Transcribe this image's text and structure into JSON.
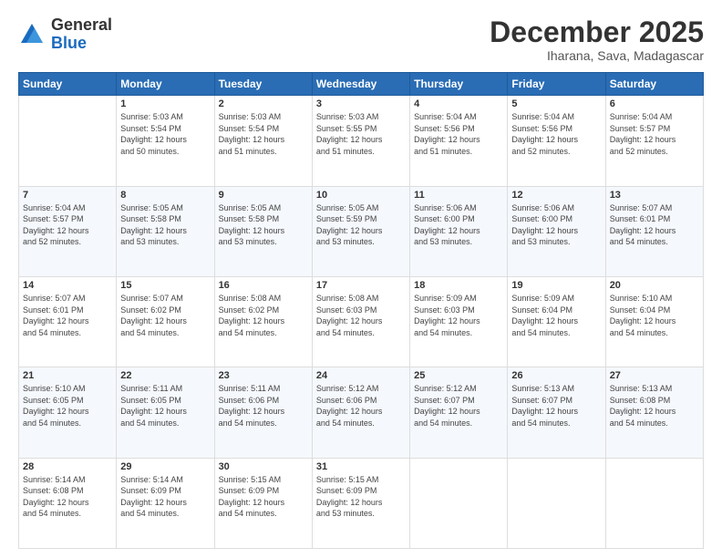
{
  "header": {
    "logo_general": "General",
    "logo_blue": "Blue",
    "month_title": "December 2025",
    "subtitle": "Iharana, Sava, Madagascar"
  },
  "weekdays": [
    "Sunday",
    "Monday",
    "Tuesday",
    "Wednesday",
    "Thursday",
    "Friday",
    "Saturday"
  ],
  "weeks": [
    [
      {
        "day": "",
        "info": ""
      },
      {
        "day": "1",
        "info": "Sunrise: 5:03 AM\nSunset: 5:54 PM\nDaylight: 12 hours\nand 50 minutes."
      },
      {
        "day": "2",
        "info": "Sunrise: 5:03 AM\nSunset: 5:54 PM\nDaylight: 12 hours\nand 51 minutes."
      },
      {
        "day": "3",
        "info": "Sunrise: 5:03 AM\nSunset: 5:55 PM\nDaylight: 12 hours\nand 51 minutes."
      },
      {
        "day": "4",
        "info": "Sunrise: 5:04 AM\nSunset: 5:56 PM\nDaylight: 12 hours\nand 51 minutes."
      },
      {
        "day": "5",
        "info": "Sunrise: 5:04 AM\nSunset: 5:56 PM\nDaylight: 12 hours\nand 52 minutes."
      },
      {
        "day": "6",
        "info": "Sunrise: 5:04 AM\nSunset: 5:57 PM\nDaylight: 12 hours\nand 52 minutes."
      }
    ],
    [
      {
        "day": "7",
        "info": "Sunrise: 5:04 AM\nSunset: 5:57 PM\nDaylight: 12 hours\nand 52 minutes."
      },
      {
        "day": "8",
        "info": "Sunrise: 5:05 AM\nSunset: 5:58 PM\nDaylight: 12 hours\nand 53 minutes."
      },
      {
        "day": "9",
        "info": "Sunrise: 5:05 AM\nSunset: 5:58 PM\nDaylight: 12 hours\nand 53 minutes."
      },
      {
        "day": "10",
        "info": "Sunrise: 5:05 AM\nSunset: 5:59 PM\nDaylight: 12 hours\nand 53 minutes."
      },
      {
        "day": "11",
        "info": "Sunrise: 5:06 AM\nSunset: 6:00 PM\nDaylight: 12 hours\nand 53 minutes."
      },
      {
        "day": "12",
        "info": "Sunrise: 5:06 AM\nSunset: 6:00 PM\nDaylight: 12 hours\nand 53 minutes."
      },
      {
        "day": "13",
        "info": "Sunrise: 5:07 AM\nSunset: 6:01 PM\nDaylight: 12 hours\nand 54 minutes."
      }
    ],
    [
      {
        "day": "14",
        "info": "Sunrise: 5:07 AM\nSunset: 6:01 PM\nDaylight: 12 hours\nand 54 minutes."
      },
      {
        "day": "15",
        "info": "Sunrise: 5:07 AM\nSunset: 6:02 PM\nDaylight: 12 hours\nand 54 minutes."
      },
      {
        "day": "16",
        "info": "Sunrise: 5:08 AM\nSunset: 6:02 PM\nDaylight: 12 hours\nand 54 minutes."
      },
      {
        "day": "17",
        "info": "Sunrise: 5:08 AM\nSunset: 6:03 PM\nDaylight: 12 hours\nand 54 minutes."
      },
      {
        "day": "18",
        "info": "Sunrise: 5:09 AM\nSunset: 6:03 PM\nDaylight: 12 hours\nand 54 minutes."
      },
      {
        "day": "19",
        "info": "Sunrise: 5:09 AM\nSunset: 6:04 PM\nDaylight: 12 hours\nand 54 minutes."
      },
      {
        "day": "20",
        "info": "Sunrise: 5:10 AM\nSunset: 6:04 PM\nDaylight: 12 hours\nand 54 minutes."
      }
    ],
    [
      {
        "day": "21",
        "info": "Sunrise: 5:10 AM\nSunset: 6:05 PM\nDaylight: 12 hours\nand 54 minutes."
      },
      {
        "day": "22",
        "info": "Sunrise: 5:11 AM\nSunset: 6:05 PM\nDaylight: 12 hours\nand 54 minutes."
      },
      {
        "day": "23",
        "info": "Sunrise: 5:11 AM\nSunset: 6:06 PM\nDaylight: 12 hours\nand 54 minutes."
      },
      {
        "day": "24",
        "info": "Sunrise: 5:12 AM\nSunset: 6:06 PM\nDaylight: 12 hours\nand 54 minutes."
      },
      {
        "day": "25",
        "info": "Sunrise: 5:12 AM\nSunset: 6:07 PM\nDaylight: 12 hours\nand 54 minutes."
      },
      {
        "day": "26",
        "info": "Sunrise: 5:13 AM\nSunset: 6:07 PM\nDaylight: 12 hours\nand 54 minutes."
      },
      {
        "day": "27",
        "info": "Sunrise: 5:13 AM\nSunset: 6:08 PM\nDaylight: 12 hours\nand 54 minutes."
      }
    ],
    [
      {
        "day": "28",
        "info": "Sunrise: 5:14 AM\nSunset: 6:08 PM\nDaylight: 12 hours\nand 54 minutes."
      },
      {
        "day": "29",
        "info": "Sunrise: 5:14 AM\nSunset: 6:09 PM\nDaylight: 12 hours\nand 54 minutes."
      },
      {
        "day": "30",
        "info": "Sunrise: 5:15 AM\nSunset: 6:09 PM\nDaylight: 12 hours\nand 54 minutes."
      },
      {
        "day": "31",
        "info": "Sunrise: 5:15 AM\nSunset: 6:09 PM\nDaylight: 12 hours\nand 53 minutes."
      },
      {
        "day": "",
        "info": ""
      },
      {
        "day": "",
        "info": ""
      },
      {
        "day": "",
        "info": ""
      }
    ]
  ]
}
